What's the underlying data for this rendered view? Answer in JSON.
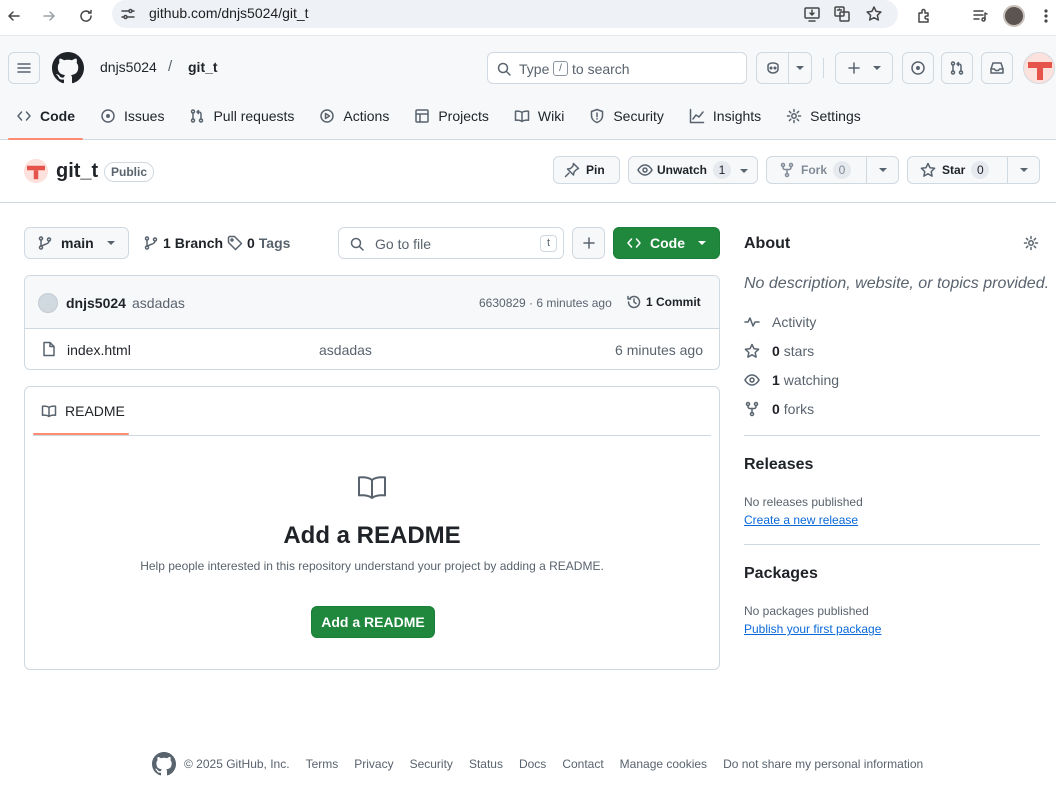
{
  "browser": {
    "url": "github.com/dnjs5024/git_t"
  },
  "header": {
    "owner": "dnjs5024",
    "separator": "/",
    "repo": "git_t",
    "search_prefix": "Type",
    "search_key": "/",
    "search_suffix": "to search"
  },
  "tabs": [
    {
      "label": "Code",
      "icon": "code-icon",
      "active": true
    },
    {
      "label": "Issues",
      "icon": "issue-icon"
    },
    {
      "label": "Pull requests",
      "icon": "pull-request-icon"
    },
    {
      "label": "Actions",
      "icon": "play-icon"
    },
    {
      "label": "Projects",
      "icon": "table-icon"
    },
    {
      "label": "Wiki",
      "icon": "book-icon"
    },
    {
      "label": "Security",
      "icon": "shield-icon"
    },
    {
      "label": "Insights",
      "icon": "graph-icon"
    },
    {
      "label": "Settings",
      "icon": "gear-icon"
    }
  ],
  "repo": {
    "name": "git_t",
    "visibility": "Public",
    "pin_label": "Pin",
    "unwatch_label": "Unwatch",
    "watch_count": "1",
    "fork_label": "Fork",
    "fork_count": "0",
    "star_label": "Star",
    "star_count": "0"
  },
  "filenav": {
    "branch": "main",
    "branches_count": "1",
    "branches_label": "Branch",
    "tags_count": "0",
    "tags_label": "Tags",
    "goto_placeholder": "Go to file",
    "goto_key": "t",
    "code_label": "Code"
  },
  "commit": {
    "author": "dnjs5024",
    "message": "asdadas",
    "meta": "6630829 · 6 minutes ago",
    "count_label": "1 Commit"
  },
  "files": [
    {
      "name": "index.html",
      "message": "asdadas",
      "time": "6 minutes ago",
      "icon": "file-icon"
    }
  ],
  "readme": {
    "tab_label": "README",
    "heading": "Add a README",
    "help": "Help people interested in this repository understand your project by adding a README.",
    "button": "Add a README"
  },
  "about": {
    "heading": "About",
    "description": "No description, website, or topics provided.",
    "activity_label": "Activity",
    "stars_count": "0",
    "stars_label": "stars",
    "watching_count": "1",
    "watching_label": "watching",
    "forks_count": "0",
    "forks_label": "forks"
  },
  "releases": {
    "heading": "Releases",
    "none": "No releases published",
    "link": "Create a new release"
  },
  "packages": {
    "heading": "Packages",
    "none": "No packages published",
    "link": "Publish your first package"
  },
  "footer": {
    "copyright": "© 2025 GitHub, Inc.",
    "links": [
      "Terms",
      "Privacy",
      "Security",
      "Status",
      "Docs",
      "Contact",
      "Manage cookies",
      "Do not share my personal information"
    ]
  },
  "colors": {
    "accent_green": "#1f883d",
    "tab_underline": "#fd8c73",
    "link_blue": "#0969da"
  }
}
